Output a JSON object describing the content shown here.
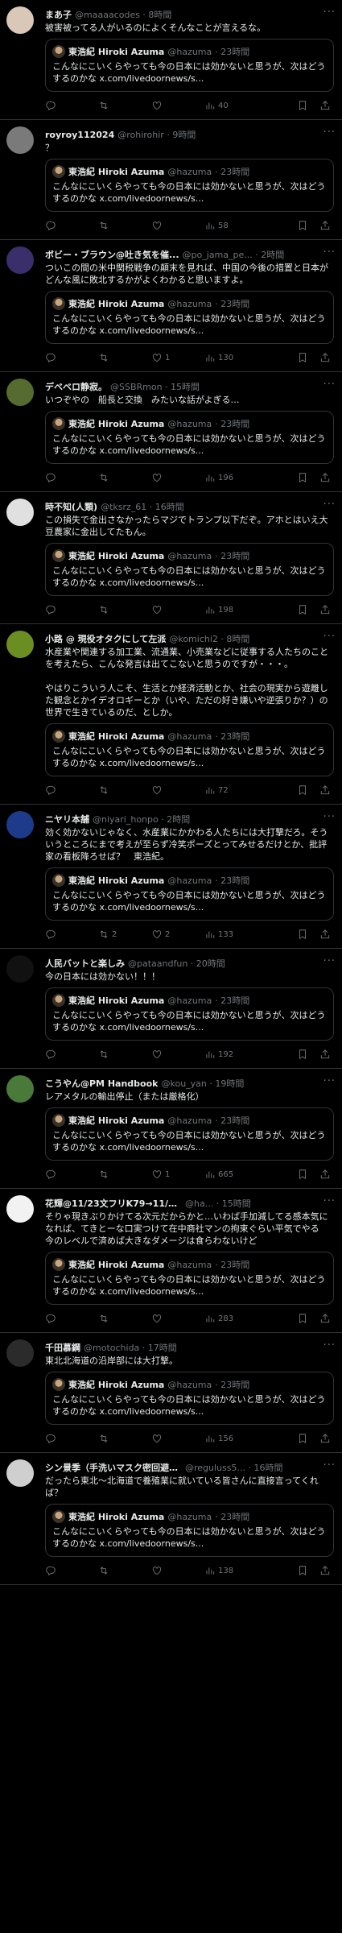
{
  "quote": {
    "author_name": "東浩紀 Hiroki Azuma",
    "author_handle": "@hazuma",
    "author_time": "· 23時間",
    "text": "こんなにこいくらやっても今の日本には効かないと思うが、次はどうするのかな x.com/livedoornews/s..."
  },
  "posts": [
    {
      "name": "まあ子",
      "meta": "@maaaacodes · 8時間",
      "text": "被害被ってる人がいるのによくそんなことが言えるな。",
      "views": "40",
      "reply": "",
      "retweet": "",
      "like": "",
      "avatar_color": "#d9c8b8"
    },
    {
      "name": "royroy112024",
      "meta": "@rohirohir · 9時間",
      "text": "？",
      "views": "58",
      "reply": "",
      "retweet": "",
      "like": "",
      "avatar_color": "#7a7a7a"
    },
    {
      "name": "ボビー・ブラウン@吐き気を催...",
      "meta": "@po_jama_pe... · 2時間",
      "text": "ついこの間の米中関税戦争の顛末を見れば、中国の今後の措置と日本がどんな風に敗北するかがよくわかると思いますよ。",
      "views": "130",
      "reply": "",
      "retweet": "",
      "like": "1",
      "avatar_color": "#3a2f6b"
    },
    {
      "name": "デベベロ静寂。",
      "meta": "@SSBRmon · 15時間",
      "text": "いつぞやの　船長と交換　みたいな話がよぎる…",
      "views": "196",
      "reply": "",
      "retweet": "",
      "like": "",
      "avatar_color": "#556b2f"
    },
    {
      "name": "時不知(人類)",
      "meta": "@tksrz_61 · 16時間",
      "text": "この損失で金出さなかったらマジでトランプ以下だぞ。アホとはいえ大豆農家に金出してたもん。",
      "views": "198",
      "reply": "",
      "retweet": "",
      "like": "",
      "avatar_color": "#e0e0e0"
    },
    {
      "name": "小路 @ 現役オタクにして左派",
      "meta": "@komichi2 · 8時間",
      "text": "水産業や関連する加工業、流通業、小売業などに従事する人たちのことを考えたら、こんな発言は出てこないと思うのですが・・・。\n\nやはりこういう人こそ、生活とか経済活動とか、社会の現実から遊離した観念とかイデオロギーとか（いや、ただの好き嫌いや逆張りか？）の世界で生きているのだ、としか。",
      "views": "72",
      "reply": "",
      "retweet": "",
      "like": "",
      "avatar_color": "#6b8e23"
    },
    {
      "name": "ニヤリ本舗",
      "meta": "@niyari_honpo · 2時間",
      "text": "効く効かないじゃなく、水産業にかかわる人たちには大打撃だろ。そういうところにまで考えが至らず冷笑ポーズとってみせるだけとか、批評家の看板降ろせば？　東浩紀。",
      "views": "133",
      "reply": "",
      "retweet": "2",
      "like": "2",
      "avatar_color": "#1e3a8a"
    },
    {
      "name": "人民バットと楽しみ",
      "meta": "@pataandfun · 20時間",
      "text": "今の日本には効かない！！！",
      "views": "192",
      "reply": "",
      "retweet": "",
      "like": "",
      "avatar_color": "#111111"
    },
    {
      "name": "こうやん@PM Handbook",
      "meta": "@kou_yan · 19時間",
      "text": "レアメタルの輸出停止（または厳格化）",
      "views": "665",
      "reply": "",
      "retweet": "",
      "like": "1",
      "avatar_color": "#4a7a3a"
    },
    {
      "name": "花輝@11/23文フリK79→11/24ティア...",
      "meta": "@ha... · 15時間",
      "text": "そりゃ現きぶりかけてる次元だからかと…いわば手加減してる感本気になれば、てきとーな口実つけて在中商社マンの拘束ぐらい平気でやる　今のレベルで済めば大きなダメージは食らわないけど",
      "views": "283",
      "reply": "",
      "retweet": "",
      "like": "",
      "avatar_color": "#f2f2f2"
    },
    {
      "name": "千田慕鋼",
      "meta": "@motochida · 17時間",
      "text": "東北北海道の沿岸部には大打撃。",
      "views": "156",
      "reply": "",
      "retweet": "",
      "like": "",
      "avatar_color": "#2b2b2b"
    },
    {
      "name": "シン景季（手洗いマスク密回避）...",
      "meta": "@reguluss5... · 16時間",
      "text": "だったら東北〜北海道で養殖業に就いている皆さんに直接言ってくれば？",
      "views": "138",
      "reply": "",
      "retweet": "",
      "like": "",
      "avatar_color": "#cfcfcf"
    }
  ]
}
